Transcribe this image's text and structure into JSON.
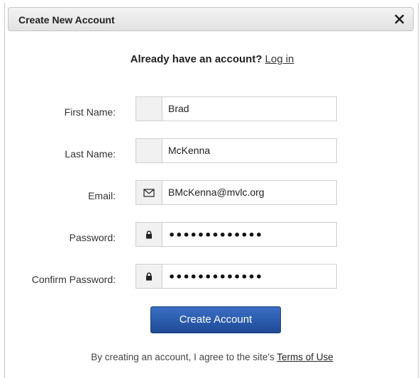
{
  "dialog": {
    "title": "Create New Account",
    "close_icon": "close-icon"
  },
  "login": {
    "lead": "Already have an account?",
    "link": "Log in"
  },
  "fields": {
    "first_name": {
      "label": "First Name:",
      "value": "Brad"
    },
    "last_name": {
      "label": "Last Name:",
      "value": "McKenna"
    },
    "email": {
      "label": "Email:",
      "value": "BMcKenna@mvlc.org",
      "icon": "envelope-icon"
    },
    "password": {
      "label": "Password:",
      "value": "•••••••••••••",
      "icon": "lock-icon"
    },
    "confirm_password": {
      "label": "Confirm Password:",
      "value": "•••••••••••••",
      "icon": "lock-icon"
    }
  },
  "actions": {
    "create_label": "Create Account"
  },
  "terms": {
    "lead": "By creating an account, I agree to the site's",
    "link": "Terms of Use"
  }
}
